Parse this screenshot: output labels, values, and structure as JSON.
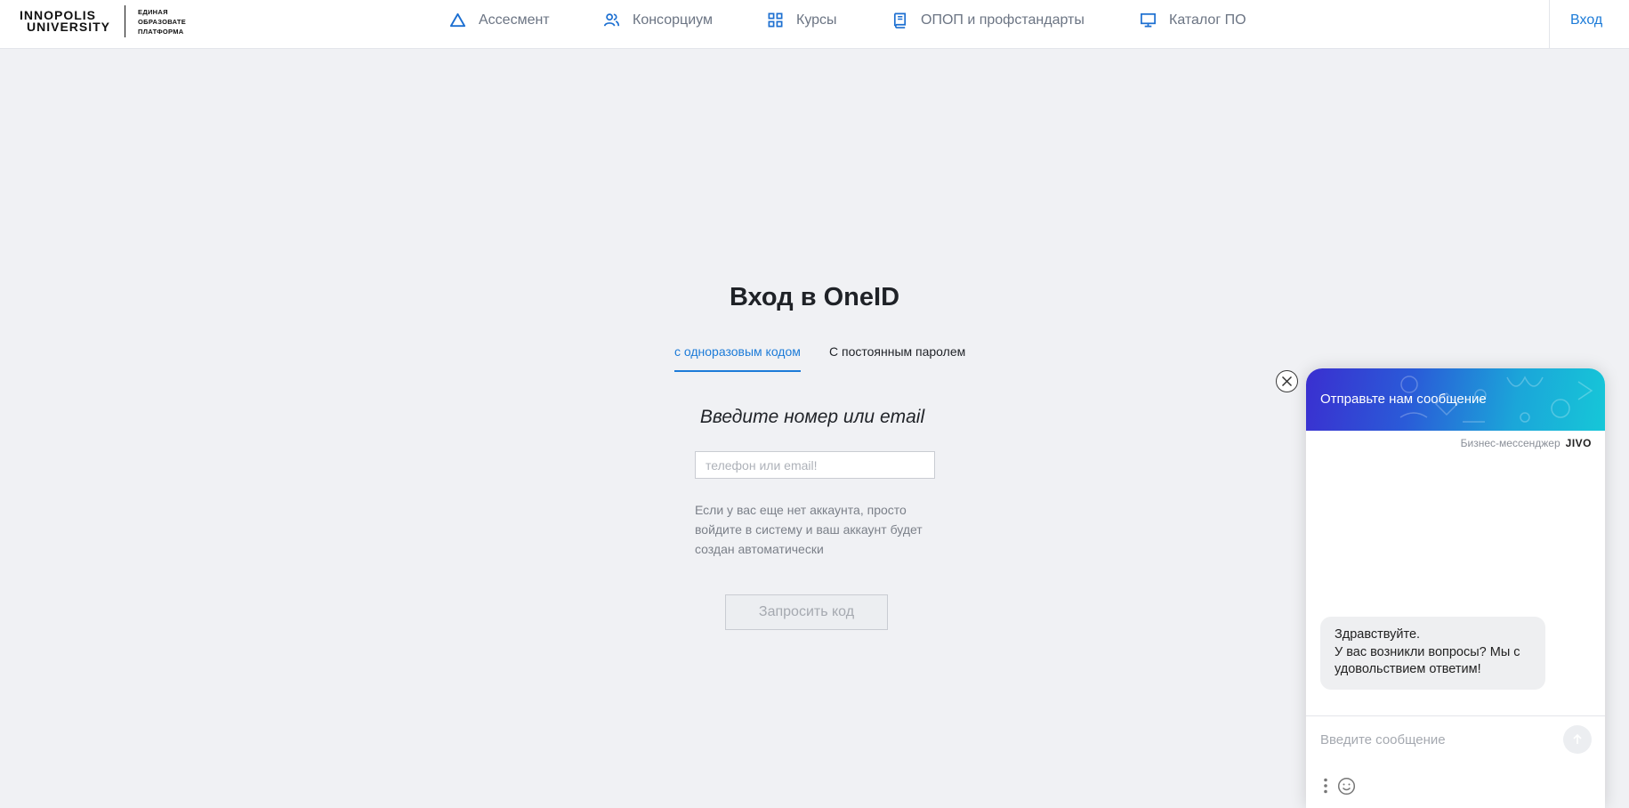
{
  "header": {
    "logo": {
      "line1": "INNOPOLIS",
      "line2": "UNIVERSITY",
      "subtitle_lines": [
        "ЕДИНАЯ",
        "ОБРАЗОВАТЕ",
        "ПЛАТФОРМА"
      ]
    },
    "nav": [
      {
        "label": "Ассесмент",
        "icon": "triangle-icon"
      },
      {
        "label": "Консорциум",
        "icon": "users-icon"
      },
      {
        "label": "Курсы",
        "icon": "grid-icon"
      },
      {
        "label": "ОПОП и профстандарты",
        "icon": "book-icon"
      },
      {
        "label": "Каталог ПО",
        "icon": "monitor-icon"
      }
    ],
    "login_label": "Вход"
  },
  "login": {
    "title": "Вход в OneID",
    "tabs": [
      {
        "label": "с одноразовым кодом",
        "active": true
      },
      {
        "label": "С постоянным паролем",
        "active": false
      }
    ],
    "subtitle": "Введите номер или email",
    "input_placeholder": "телефон или email!",
    "hint": "Если у вас еще нет аккаунта, просто войдите в систему и ваш аккаунт будет создан автоматически",
    "request_button": "Запросить код"
  },
  "chat": {
    "header_title": "Отправьте нам сообщение",
    "brand_caption": "Бизнес-мессенджер",
    "brand_name": "JIVO",
    "greeting_lines": [
      "Здравствуйте.",
      "У вас возникли вопросы? Мы с удовольствием ответим!"
    ],
    "input_placeholder": "Введите сообщение"
  },
  "colors": {
    "accent": "#1c7bd8",
    "background": "#f0f1f4",
    "chat_gradient_start": "#3a2fd0",
    "chat_gradient_end": "#16c7d8"
  }
}
